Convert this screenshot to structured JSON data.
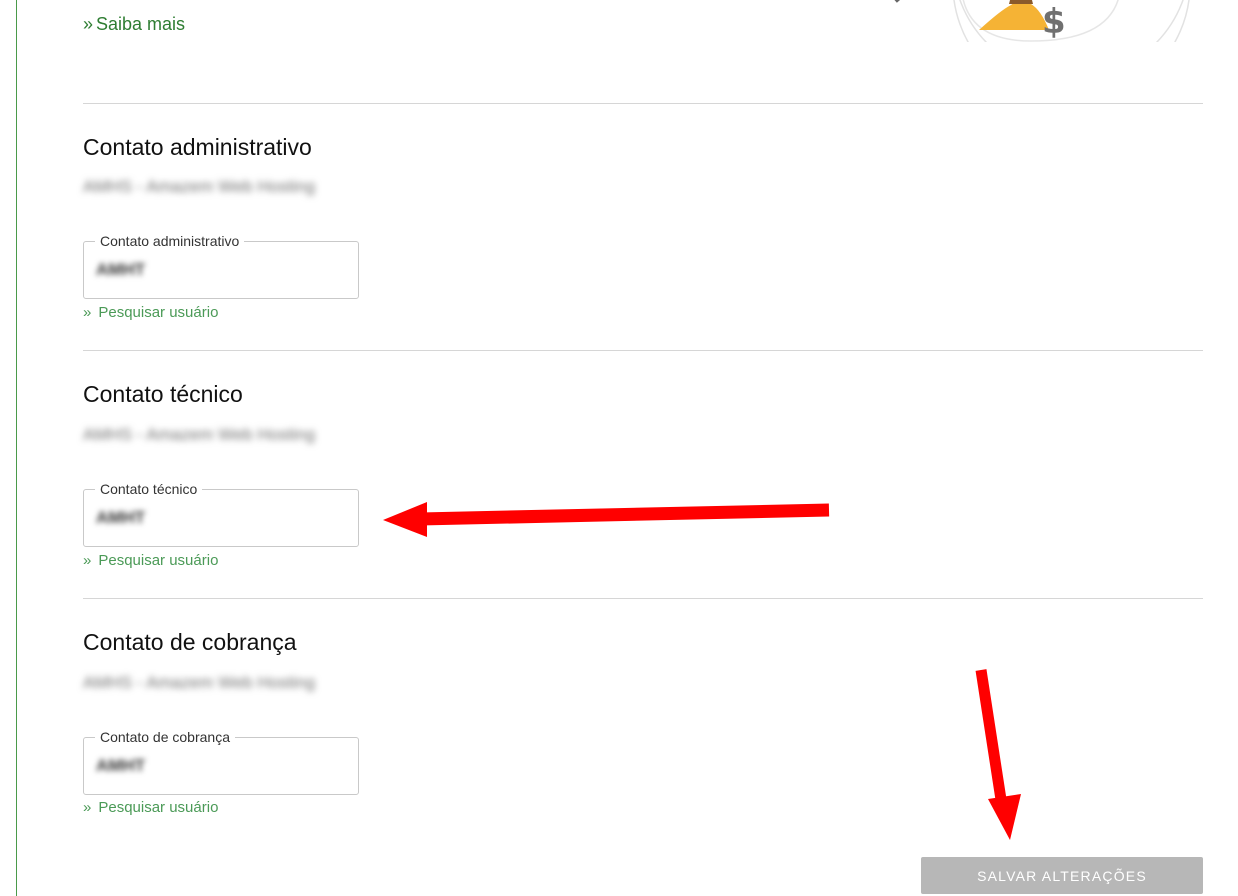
{
  "learn_more": {
    "prefix": "»",
    "label": "Saiba mais"
  },
  "sections": [
    {
      "title": "Contato administrativo",
      "subtitle": "AMHS - Amazem Web Hosting",
      "field": {
        "legend": "Contato administrativo",
        "value": "AMHT"
      },
      "search_link": {
        "prefix": "»",
        "label": "Pesquisar usuário"
      }
    },
    {
      "title": "Contato técnico",
      "subtitle": "AMHS - Amazem Web Hosting",
      "field": {
        "legend": "Contato técnico",
        "value": "AMHT"
      },
      "search_link": {
        "prefix": "»",
        "label": "Pesquisar usuário"
      }
    },
    {
      "title": "Contato de cobrança",
      "subtitle": "AMHS - Amazem Web Hosting",
      "field": {
        "legend": "Contato de cobrança",
        "value": "AMHT"
      },
      "search_link": {
        "prefix": "»",
        "label": "Pesquisar usuário"
      }
    }
  ],
  "save_button": {
    "label": "SALVAR ALTERAÇÕES"
  },
  "colors": {
    "link_green": "#4b9a57",
    "accent_green": "#2e7d32",
    "annotation_red": "#ff0000",
    "button_disabled": "#b7b7b7"
  },
  "icons": [
    "money-bag-illustration"
  ]
}
